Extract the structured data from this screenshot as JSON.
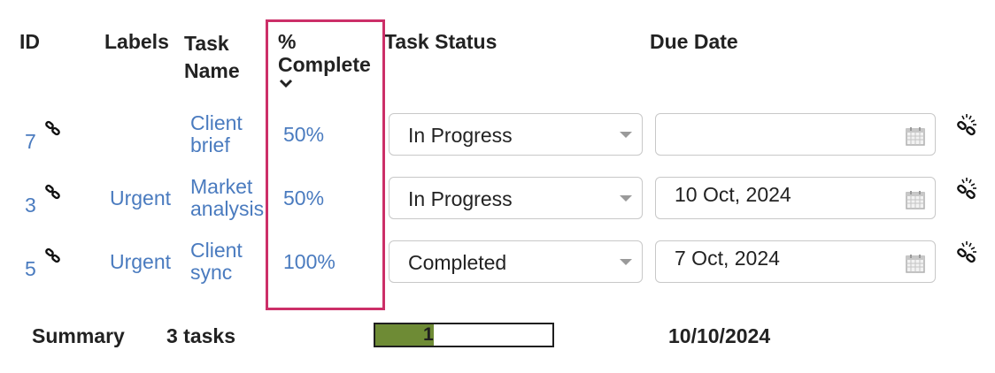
{
  "header": {
    "id": "ID",
    "labels": "Labels",
    "task_name_line1": "Task",
    "task_name_line2": "Name",
    "pct_line1": "%",
    "pct_line2": "Complete",
    "task_status": "Task Status",
    "due_date": "Due Date",
    "sort_icon": "chevron-down-icon"
  },
  "rows": [
    {
      "id": "7",
      "labels": "",
      "task_name_line1": "Client",
      "task_name_line2": "brief",
      "pct_complete": "50%",
      "status": "In Progress",
      "due_date": "",
      "link_icon": "link-icon",
      "calendar_icon": "calendar-icon",
      "unlink_icon": "unlink-icon"
    },
    {
      "id": "3",
      "labels": "Urgent",
      "task_name_line1": "Market",
      "task_name_line2": "analysis",
      "pct_complete": "50%",
      "status": "In Progress",
      "due_date": "10 Oct, 2024",
      "link_icon": "link-icon",
      "calendar_icon": "calendar-icon",
      "unlink_icon": "unlink-icon"
    },
    {
      "id": "5",
      "labels": "Urgent",
      "task_name_line1": "Client",
      "task_name_line2": "sync",
      "pct_complete": "100%",
      "status": "Completed",
      "due_date": "7 Oct, 2024",
      "link_icon": "link-icon",
      "calendar_icon": "calendar-icon",
      "unlink_icon": "unlink-icon"
    }
  ],
  "summary": {
    "label": "Summary",
    "count": "3 tasks",
    "progress_text": "1",
    "progress_fraction": 0.33,
    "due_date": "10/10/2024"
  },
  "colors": {
    "link": "#4a7bbf",
    "highlight_border": "#cc2f68",
    "progress_fill": "#6e8b35"
  }
}
